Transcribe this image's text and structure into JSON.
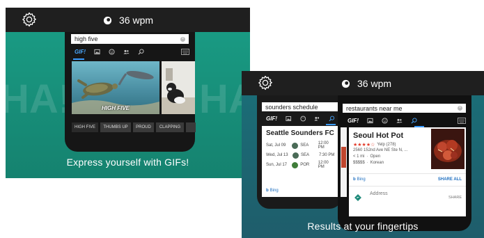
{
  "left_card": {
    "wpm": "36 wpm",
    "bg_text": "HA!",
    "search": {
      "value": "high five"
    },
    "tabs": {
      "gif_label": "GIF!"
    },
    "gif_caption": "HIGH FIVE",
    "chips": [
      "HIGH FIVE",
      "THUMBS UP",
      "PROUD",
      "CLAPPING"
    ],
    "caption": "Express yourself with GIFs!",
    "colors": {
      "bg": "#1a9e86",
      "accent": "#3b9cff"
    }
  },
  "right_card": {
    "wpm": "36 wpm",
    "back_search": {
      "value": "sounders schedule"
    },
    "front_search": {
      "value": "restaurants near me"
    },
    "tabs": {
      "gif_label": "GIF!"
    },
    "schedule": {
      "title": "Seattle Sounders FC",
      "rows": [
        {
          "date": "Sat, Jul 09",
          "team": "SEA",
          "time": "12:00 PM"
        },
        {
          "date": "Wed, Jul 13",
          "team": "SEA",
          "time": "7:30 PM"
        },
        {
          "date": "Sun, Jul 17",
          "team": "POR",
          "time": "12:00 PM"
        }
      ],
      "source": "Bing"
    },
    "restaurant": {
      "name": "Seoul Hot Pot",
      "stars": "★★★★☆",
      "rating_text": "Yelp (278)",
      "address": "2560 152nd Ave NE Ste N, ...",
      "distance": "< 1 mi",
      "sep": "·",
      "status": "Open",
      "price": "$$$$$",
      "cuisine": "Korean",
      "source": "Bing",
      "share_all": "SHARE ALL",
      "address_label": "Address",
      "share": "SHARE"
    },
    "caption": "Results at your fingertips",
    "colors": {
      "bg": "#1a6f78",
      "stars": "#e23b2a",
      "accent": "#3b9cff"
    }
  }
}
